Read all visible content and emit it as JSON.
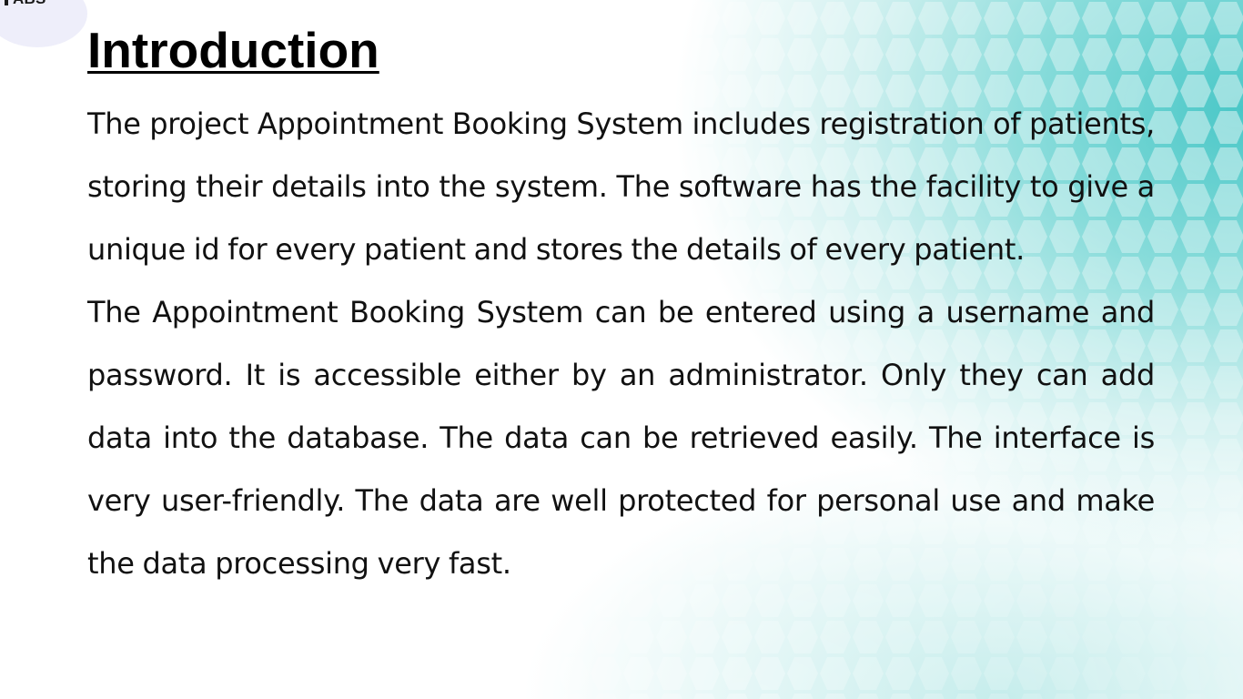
{
  "logo": {
    "text": "ABS",
    "icon": "storefront-icon"
  },
  "slide": {
    "title": "Introduction",
    "paragraphs": [
      "The project Appointment Booking System includes registration of patients, storing their details into the system. The software has the facility to give a unique id for every patient and stores the details of every patient.",
      "The Appointment Booking System can be entered using a username and password. It is accessible either by an administrator. Only they can add data into the database. The data can be retrieved easily. The interface is very user-friendly. The data are well protected for personal use and make the data processing very fast."
    ]
  },
  "colors": {
    "accent_teal": "#40c4c4",
    "text": "#111111",
    "background": "#ffffff"
  }
}
